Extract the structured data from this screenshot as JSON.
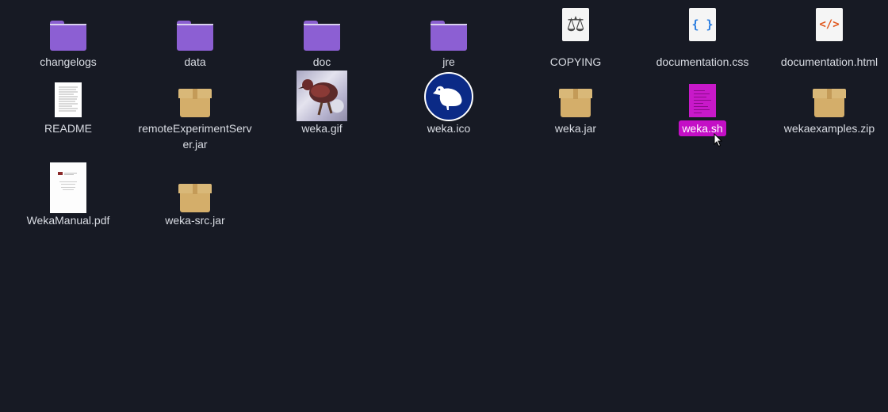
{
  "files": [
    {
      "name": "changelogs"
    },
    {
      "name": "data"
    },
    {
      "name": "doc"
    },
    {
      "name": "jre"
    },
    {
      "name": "COPYING"
    },
    {
      "name": "documentation.css"
    },
    {
      "name": "documentation.html"
    },
    {
      "name": "README"
    },
    {
      "name": "remoteExperimentServer.jar"
    },
    {
      "name": "weka.gif"
    },
    {
      "name": "weka.ico"
    },
    {
      "name": "weka.jar"
    },
    {
      "name": "weka.sh",
      "selected": true
    },
    {
      "name": "wekaexamples.zip"
    },
    {
      "name": "WekaManual.pdf"
    },
    {
      "name": "weka-src.jar"
    }
  ],
  "icons": {
    "css_glyph": "{ }",
    "html_glyph": "</>",
    "copying_glyph": "⚖"
  },
  "colors": {
    "background": "#171a24",
    "folder": "#8c5fd3",
    "selection": "#c40fc6",
    "archive": "#d4ae6a"
  }
}
